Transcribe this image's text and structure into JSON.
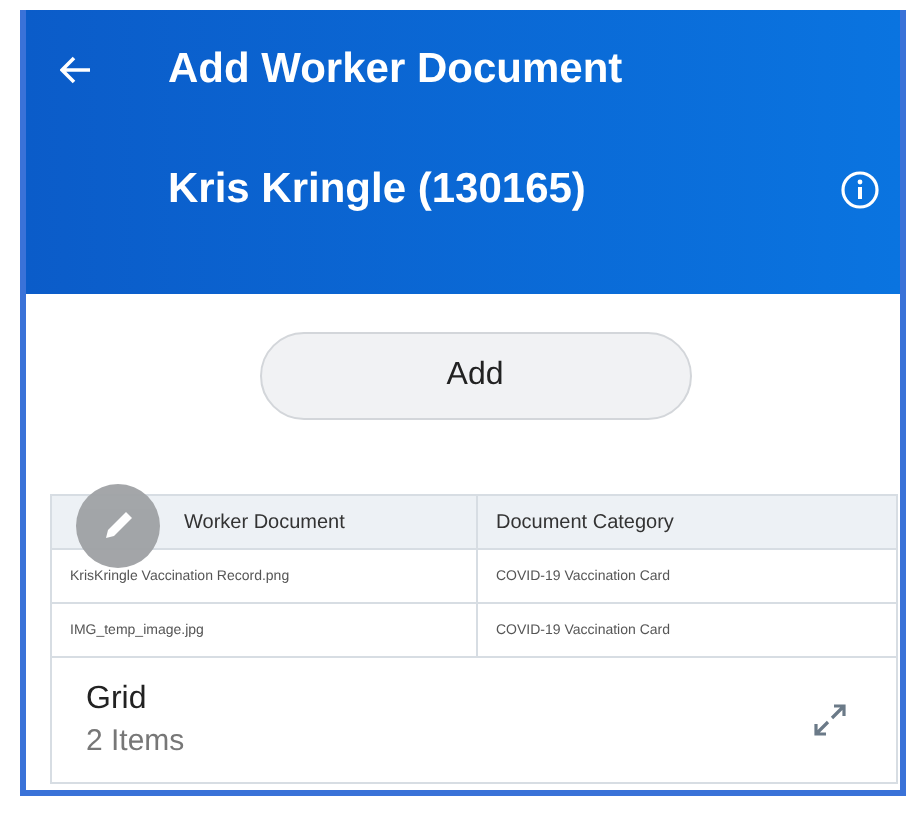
{
  "header": {
    "title": "Add Worker Document",
    "subtitle": "Kris Kringle (130165)"
  },
  "add_button": "Add",
  "table": {
    "columns": [
      "Worker Document",
      "Document Category"
    ],
    "rows": [
      [
        "KrisKringle Vaccination Record.png",
        "COVID-19 Vaccination Card"
      ],
      [
        "IMG_temp_image.jpg",
        "COVID-19 Vaccination Card"
      ]
    ],
    "footer": {
      "title": "Grid",
      "count": "2 Items"
    }
  }
}
